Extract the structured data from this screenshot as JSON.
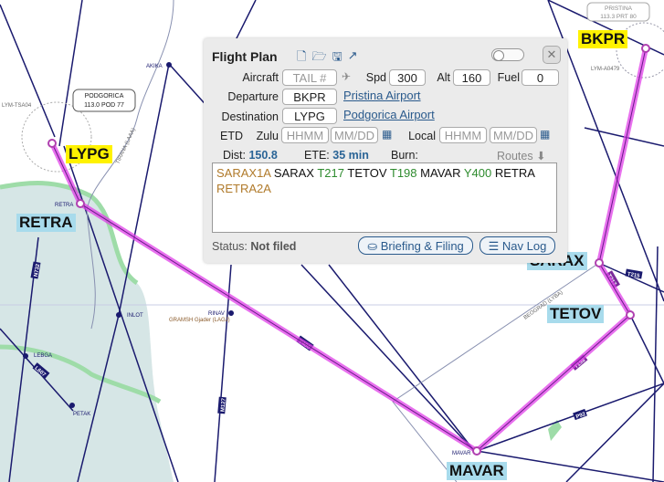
{
  "map": {
    "waypoints": {
      "bkpr": "BKPR",
      "lypg": "LYPG",
      "retra": "RETRA",
      "sarax": "SARAX",
      "tetov": "TETOV",
      "mavar": "MAVAR"
    },
    "map_fixes": [
      "AKIKA",
      "INLOT",
      "RINAV",
      "LEBGA",
      "PETAK",
      "RETRA",
      "MAVAR"
    ],
    "navaids": {
      "podgorica_name": "PODGORICA",
      "podgorica_freq": "113.0 POD 77",
      "pristina_name": "PRISTINA",
      "pristina_freq": "113.3 PRT 80"
    },
    "airways": [
      "Y400",
      "T198",
      "T217",
      "M127",
      "L607",
      "N732",
      "P92",
      "T215"
    ],
    "airspace_labels": [
      "BEOGRAD (LYBA)",
      "TIRANA (LAAA)",
      "LYM-TSA04",
      "LYM-A0479"
    ],
    "area_labels": [
      "GRAMSH Gjader (LAGJ)"
    ],
    "route_color": "#e040e8",
    "airport_label_color": "#fff200",
    "fix_label_color": "#a8dbec"
  },
  "panel": {
    "title": "Flight Plan",
    "icons": [
      "new-file-icon",
      "open-folder-icon",
      "save-icon",
      "share-icon"
    ],
    "close": "✕",
    "aircraft_label": "Aircraft",
    "aircraft_placeholder": "TAIL #",
    "spd_label": "Spd",
    "spd": "300",
    "alt_label": "Alt",
    "alt": "160",
    "fuel_label": "Fuel",
    "fuel": "0",
    "departure_label": "Departure",
    "departure": "BKPR",
    "departure_name": "Pristina Airport",
    "destination_label": "Destination",
    "destination": "LYPG",
    "destination_name": "Podgorica Airport",
    "etd_label": "ETD",
    "zulu_label": "Zulu",
    "local_label": "Local",
    "time_placeholder": "HHMM",
    "date_placeholder": "MM/DD",
    "dist_label": "Dist:",
    "dist": "150.8",
    "ete_label": "ETE:",
    "ete": "35 min",
    "burn_label": "Burn:",
    "routes_label": "Routes",
    "route_tokens": [
      {
        "text": "SARAX1A",
        "type": "procedure"
      },
      {
        "text": "SARAX",
        "type": "fix"
      },
      {
        "text": "T217",
        "type": "airway"
      },
      {
        "text": "TETOV",
        "type": "fix"
      },
      {
        "text": "T198",
        "type": "airway"
      },
      {
        "text": "MAVAR",
        "type": "fix"
      },
      {
        "text": "Y400",
        "type": "airway"
      },
      {
        "text": "RETRA",
        "type": "fix"
      },
      {
        "text": "RETRA2A",
        "type": "procedure"
      }
    ],
    "token_colors": {
      "procedure": "#b07a2a",
      "fix": "#111111",
      "airway": "#2e8b2e"
    },
    "status_label": "Status:",
    "status": "Not filed",
    "briefing_button": "Briefing & Filing",
    "navlog_button": "Nav Log"
  }
}
